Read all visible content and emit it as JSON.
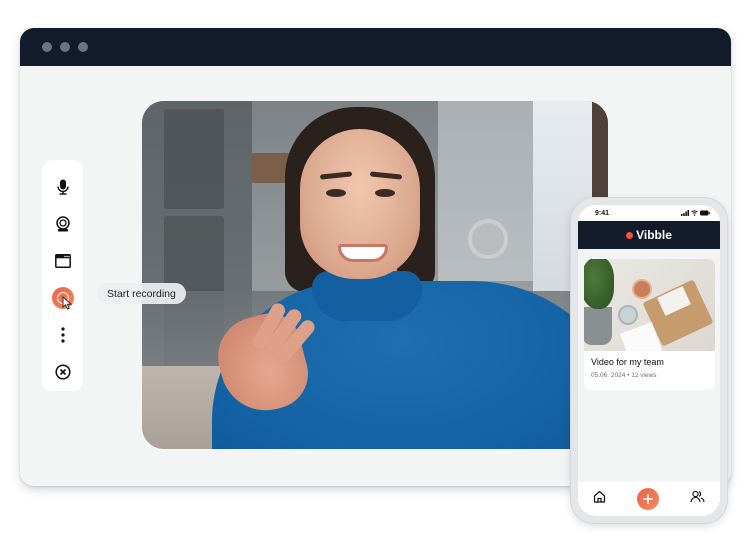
{
  "window": {
    "controls": [
      "dot",
      "dot",
      "dot"
    ]
  },
  "video": {
    "description": "Webcam preview of a smiling woman in a blue turtleneck"
  },
  "toolbar": {
    "items": [
      {
        "name": "microphone",
        "icon": "microphone-icon"
      },
      {
        "name": "webcam",
        "icon": "webcam-icon"
      },
      {
        "name": "screen",
        "icon": "browser-window-icon"
      },
      {
        "name": "record",
        "icon": "record-icon"
      },
      {
        "name": "more",
        "icon": "more-vertical-icon"
      },
      {
        "name": "close",
        "icon": "close-circle-icon"
      }
    ],
    "tooltip": "Start recording"
  },
  "phone": {
    "status": {
      "time": "9:41"
    },
    "app": {
      "brand": "Vibble",
      "accent": "#f2513b"
    },
    "card": {
      "title": "Video for my team",
      "meta": "05.06. 2024 • 12 views"
    },
    "tabs": [
      {
        "name": "home",
        "icon": "home-icon"
      },
      {
        "name": "add",
        "icon": "plus-icon"
      },
      {
        "name": "team",
        "icon": "users-icon"
      }
    ]
  },
  "colors": {
    "titlebar": "#131a29",
    "accent": "#f2614a",
    "window_bg": "#f3f4f4"
  }
}
